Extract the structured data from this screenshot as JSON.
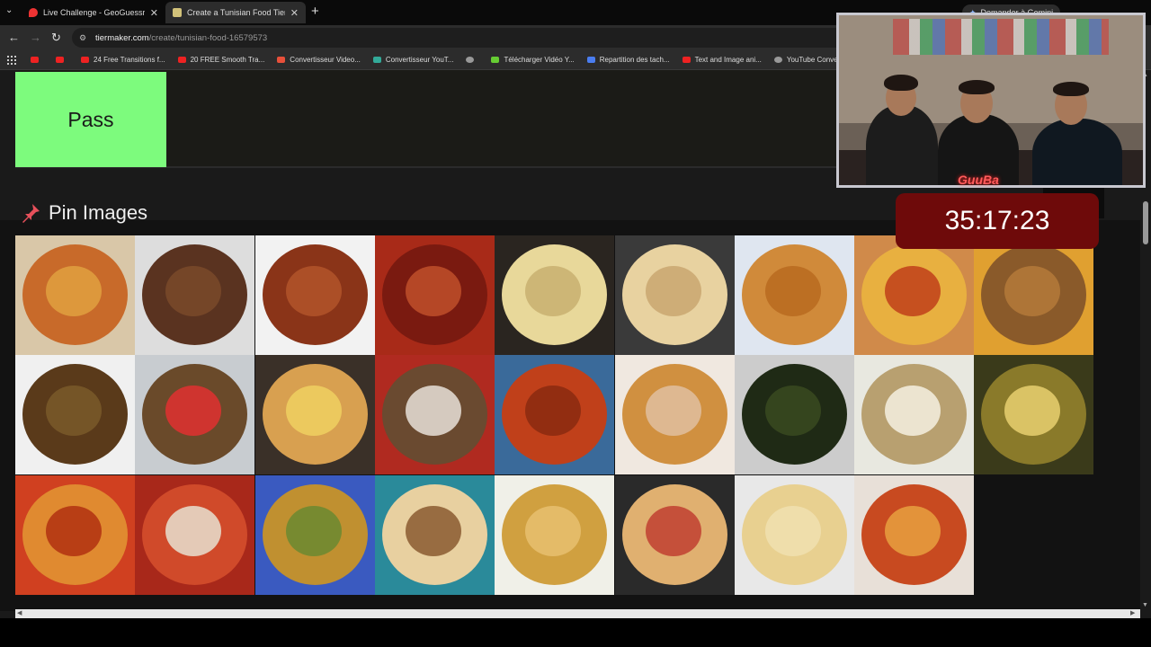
{
  "browser": {
    "tabs": [
      {
        "title": "Live Challenge - GeoGuessr",
        "active": false
      },
      {
        "title": "Create a Tunisian Food Tier List",
        "active": true
      }
    ],
    "gemini_label": "Demander à Gemini",
    "url_host": "tiermaker.com",
    "url_path": "/create/tunisian-food-16579573",
    "bookmarks": [
      {
        "label": "",
        "icon": "youtube-icon"
      },
      {
        "label": "",
        "icon": "youtube-icon"
      },
      {
        "label": "24 Free Transitions f...",
        "icon": "youtube-icon"
      },
      {
        "label": "20 FREE Smooth Tra...",
        "icon": "youtube-icon"
      },
      {
        "label": "Convertisseur Video...",
        "icon": "z-icon"
      },
      {
        "label": "Convertisseur YouT...",
        "icon": "convert-icon"
      },
      {
        "label": "",
        "icon": "globe-icon"
      },
      {
        "label": "Télécharger Vidéo Y...",
        "icon": "download-icon"
      },
      {
        "label": "Repartition des tach...",
        "icon": "docs-icon"
      },
      {
        "label": "Text and Image ani...",
        "icon": "youtube-icon"
      },
      {
        "label": "YouTube Converter...",
        "icon": "globe-icon"
      }
    ]
  },
  "page": {
    "tier_label": "Pass",
    "pin_heading": "Pin Images"
  },
  "overlay": {
    "timer": "35:17:23",
    "neon_text": "GuuBa"
  },
  "colors": {
    "tier_pass": "#7dfb7d",
    "timer_bg": "#6e0a0a"
  }
}
